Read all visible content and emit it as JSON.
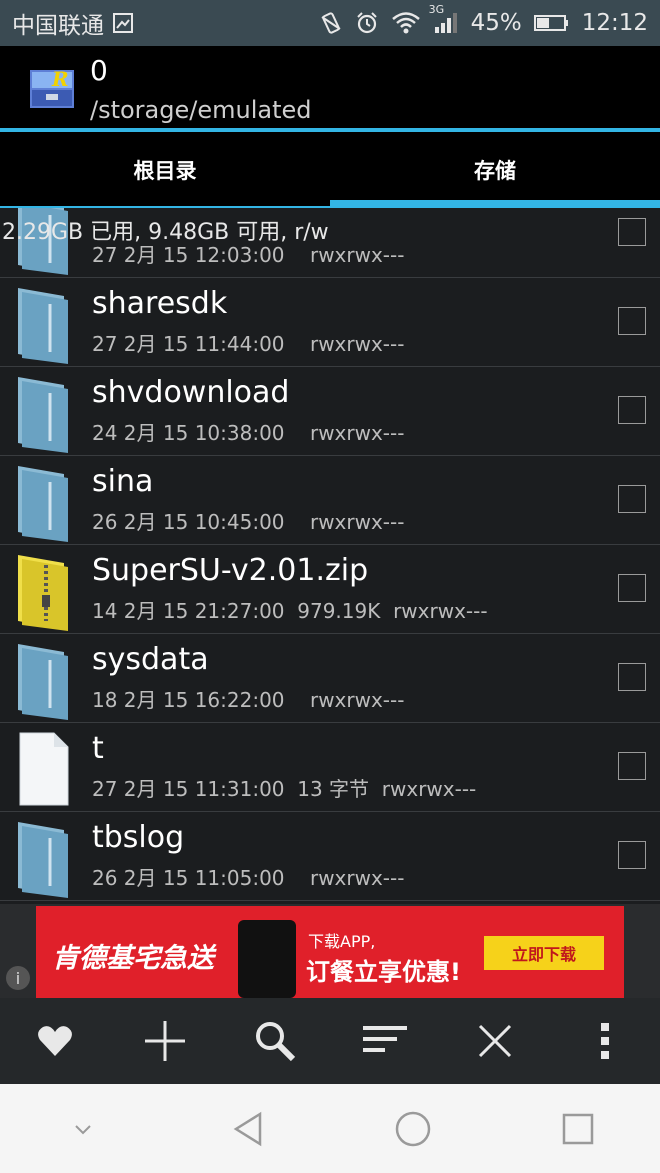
{
  "status_bar": {
    "carrier": "中国联通",
    "network": "3G",
    "battery": "45%",
    "time": "12:12"
  },
  "header": {
    "title": "0",
    "path": "/storage/emulated"
  },
  "tabs": [
    {
      "label": "根目录",
      "active": true
    },
    {
      "label": "存储",
      "active": false
    }
  ],
  "storage_info": "2.29GB 已用, 9.48GB 可用, r/w",
  "files": [
    {
      "name": "",
      "date": "27 2月 15 12:03:00",
      "size": "",
      "perms": "rwxrwx---",
      "type": "folder"
    },
    {
      "name": "sharesdk",
      "date": "27 2月 15 11:44:00",
      "size": "",
      "perms": "rwxrwx---",
      "type": "folder"
    },
    {
      "name": "shvdownload",
      "date": "24 2月 15 10:38:00",
      "size": "",
      "perms": "rwxrwx---",
      "type": "folder"
    },
    {
      "name": "sina",
      "date": "26 2月 15 10:45:00",
      "size": "",
      "perms": "rwxrwx---",
      "type": "folder"
    },
    {
      "name": "SuperSU-v2.01.zip",
      "date": "14 2月 15 21:27:00",
      "size": "979.19K",
      "perms": "rwxrwx---",
      "type": "zip"
    },
    {
      "name": "sysdata",
      "date": "18 2月 15 16:22:00",
      "size": "",
      "perms": "rwxrwx---",
      "type": "folder"
    },
    {
      "name": "t",
      "date": "27 2月 15 11:31:00",
      "size": "13 字节",
      "perms": "rwxrwx---",
      "type": "file"
    },
    {
      "name": "tbslog",
      "date": "26 2月 15 11:05:00",
      "size": "",
      "perms": "rwxrwx---",
      "type": "folder"
    }
  ],
  "ad": {
    "brand": "肯德基宅急送",
    "line1": "下载APP,",
    "line2": "订餐立享优惠!",
    "button": "立即下载",
    "info_icon": "info-icon"
  },
  "toolbar": [
    "heart-icon",
    "plus-icon",
    "search-icon",
    "sort-icon",
    "close-icon",
    "more-icon"
  ],
  "navbar": [
    "chevron-down-icon",
    "back-icon",
    "home-icon",
    "recents-icon"
  ],
  "colors": {
    "accent": "#33b5e5",
    "folder": "#7fb3cf",
    "zip": "#e7d437"
  }
}
